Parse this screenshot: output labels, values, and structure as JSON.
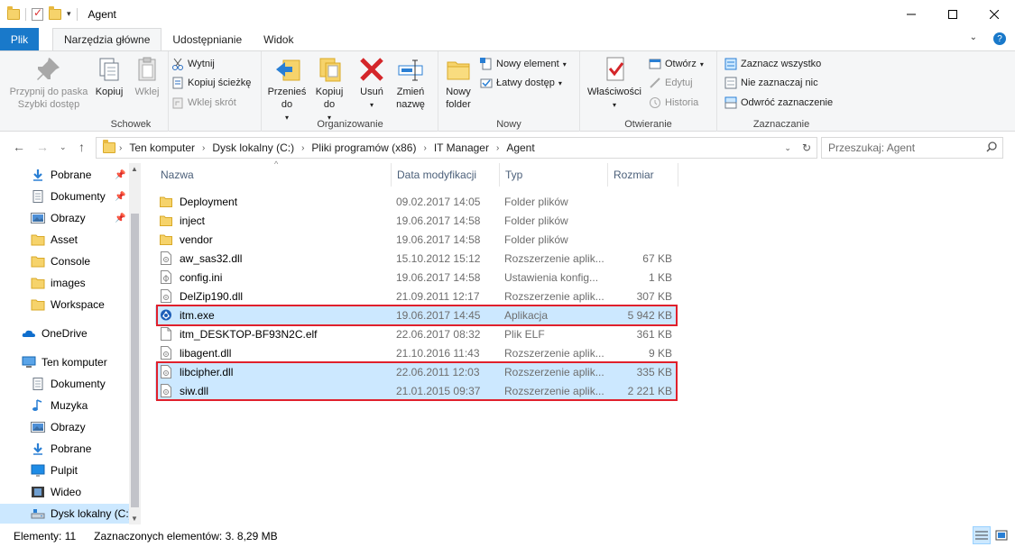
{
  "window": {
    "title": "Agent"
  },
  "ribbon_tabs": {
    "file": "Plik",
    "items": [
      "Narzędzia główne",
      "Udostępnianie",
      "Widok"
    ]
  },
  "ribbon": {
    "schowek": {
      "label": "Schowek",
      "pin": "Przypnij do paska Szybki dostęp",
      "copy": "Kopiuj",
      "paste": "Wklej",
      "cut": "Wytnij",
      "copy_path": "Kopiuj ścieżkę",
      "paste_shortcut": "Wklej skrót"
    },
    "organizowanie": {
      "label": "Organizowanie",
      "move_to": "Przenieś do",
      "copy_to": "Kopiuj do",
      "delete": "Usuń",
      "rename": "Zmień nazwę"
    },
    "nowy": {
      "label": "Nowy",
      "new_folder": "Nowy folder",
      "new_item": "Nowy element",
      "easy_access": "Łatwy dostęp"
    },
    "otwieranie": {
      "label": "Otwieranie",
      "properties": "Właściwości",
      "open": "Otwórz",
      "edit": "Edytuj",
      "history": "Historia"
    },
    "zaznaczanie": {
      "label": "Zaznaczanie",
      "select_all": "Zaznacz wszystko",
      "select_none": "Nie zaznaczaj nic",
      "invert": "Odwróć zaznaczenie"
    }
  },
  "address": {
    "breadcrumbs": [
      "Ten komputer",
      "Dysk lokalny (C:)",
      "Pliki programów (x86)",
      "IT Manager",
      "Agent"
    ],
    "search_placeholder": "Przeszukaj: Agent"
  },
  "nav": {
    "quick": [
      {
        "label": "Pobrane",
        "icon": "download-arrow-icon",
        "pinned": true
      },
      {
        "label": "Dokumenty",
        "icon": "documents-icon",
        "pinned": true
      },
      {
        "label": "Obrazy",
        "icon": "pictures-icon",
        "pinned": true
      },
      {
        "label": "Asset",
        "icon": "folder-icon",
        "pinned": false
      },
      {
        "label": "Console",
        "icon": "folder-icon",
        "pinned": false
      },
      {
        "label": "images",
        "icon": "folder-icon",
        "pinned": false
      },
      {
        "label": "Workspace",
        "icon": "folder-icon",
        "pinned": false
      }
    ],
    "onedrive": "OneDrive",
    "this_pc": "Ten komputer",
    "pc_items": [
      {
        "label": "Dokumenty",
        "icon": "documents-icon"
      },
      {
        "label": "Muzyka",
        "icon": "music-icon"
      },
      {
        "label": "Obrazy",
        "icon": "pictures-icon"
      },
      {
        "label": "Pobrane",
        "icon": "download-arrow-icon"
      },
      {
        "label": "Pulpit",
        "icon": "desktop-icon"
      },
      {
        "label": "Wideo",
        "icon": "video-icon"
      },
      {
        "label": "Dysk lokalny (C:)",
        "icon": "drive-icon"
      }
    ]
  },
  "columns": {
    "name": "Nazwa",
    "date": "Data modyfikacji",
    "type": "Typ",
    "size": "Rozmiar"
  },
  "files": [
    {
      "name": "Deployment",
      "date": "09.02.2017 14:05",
      "type": "Folder plików",
      "size": "",
      "icon": "folder",
      "selected": false
    },
    {
      "name": "inject",
      "date": "19.06.2017 14:58",
      "type": "Folder plików",
      "size": "",
      "icon": "folder",
      "selected": false
    },
    {
      "name": "vendor",
      "date": "19.06.2017 14:58",
      "type": "Folder plików",
      "size": "",
      "icon": "folder",
      "selected": false
    },
    {
      "name": "aw_sas32.dll",
      "date": "15.10.2012 15:12",
      "type": "Rozszerzenie aplik...",
      "size": "67 KB",
      "icon": "dll",
      "selected": false
    },
    {
      "name": "config.ini",
      "date": "19.06.2017 14:58",
      "type": "Ustawienia konfig...",
      "size": "1 KB",
      "icon": "ini",
      "selected": false
    },
    {
      "name": "DelZip190.dll",
      "date": "21.09.2011 12:17",
      "type": "Rozszerzenie aplik...",
      "size": "307 KB",
      "icon": "dll",
      "selected": false
    },
    {
      "name": "itm.exe",
      "date": "19.06.2017 14:45",
      "type": "Aplikacja",
      "size": "5 942 KB",
      "icon": "exe",
      "selected": true
    },
    {
      "name": "itm_DESKTOP-BF93N2C.elf",
      "date": "22.06.2017 08:32",
      "type": "Plik ELF",
      "size": "361 KB",
      "icon": "file",
      "selected": false
    },
    {
      "name": "libagent.dll",
      "date": "21.10.2016 11:43",
      "type": "Rozszerzenie aplik...",
      "size": "9 KB",
      "icon": "dll",
      "selected": false
    },
    {
      "name": "libcipher.dll",
      "date": "22.06.2011 12:03",
      "type": "Rozszerzenie aplik...",
      "size": "335 KB",
      "icon": "dll",
      "selected": true
    },
    {
      "name": "siw.dll",
      "date": "21.01.2015 09:37",
      "type": "Rozszerzenie aplik...",
      "size": "2 221 KB",
      "icon": "dll",
      "selected": true
    }
  ],
  "status": {
    "count": "Elementy: 11",
    "selected": "Zaznaczonych elementów: 3. 8,29 MB"
  },
  "colors": {
    "accent": "#1979ca",
    "selection": "#cce8ff",
    "highlight_box": "#e0202c"
  }
}
